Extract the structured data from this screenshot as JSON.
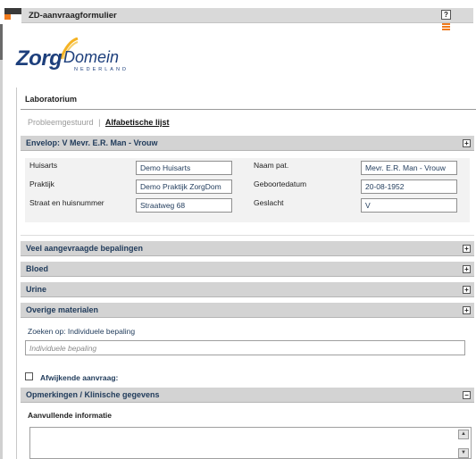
{
  "window": {
    "title": "ZD-aanvraagformulier",
    "help_glyph": "?"
  },
  "logo": {
    "word1": "Zorg",
    "word2": "Domein",
    "subtitle": "NEDERLAND"
  },
  "section_tab": "Laboratorium",
  "subtabs": {
    "inactive": "Probleemgestuurd",
    "separator": "|",
    "active": "Alfabetische lijst"
  },
  "envelope": {
    "header": "Envelop: V Mevr. E.R. Man - Vrouw",
    "toggle": "+",
    "fields": {
      "huisarts_label": "Huisarts",
      "huisarts_value": "Demo Huisarts",
      "praktijk_label": "Praktijk",
      "praktijk_value": "Demo Praktijk ZorgDom",
      "straat_label": "Straat en huisnummer",
      "straat_value": "Straatweg 68",
      "naam_label": "Naam pat.",
      "naam_value": "Mevr. E.R. Man - Vrouw",
      "geboorte_label": "Geboortedatum",
      "geboorte_value": "20-08-1952",
      "geslacht_label": "Geslacht",
      "geslacht_value": "V"
    }
  },
  "panels": [
    {
      "label": "Veel aangevraagde bepalingen",
      "toggle": "+"
    },
    {
      "label": "Bloed",
      "toggle": "+"
    },
    {
      "label": "Urine",
      "toggle": "+"
    },
    {
      "label": "Overige materialen",
      "toggle": "+"
    }
  ],
  "search": {
    "label": "Zoeken op:",
    "label_value": "Individuele bepaling",
    "placeholder": "Individuele bepaling"
  },
  "afwijkende": {
    "label": "Afwijkende aanvraag:"
  },
  "opmerkingen": {
    "header": "Opmerkingen / Klinische gegevens",
    "toggle": "−",
    "sub_label": "Aanvullende informatie"
  },
  "colors": {
    "accent": "#f07b1e",
    "brand": "#1d3f7c",
    "header_bg": "#d3d3d3"
  }
}
